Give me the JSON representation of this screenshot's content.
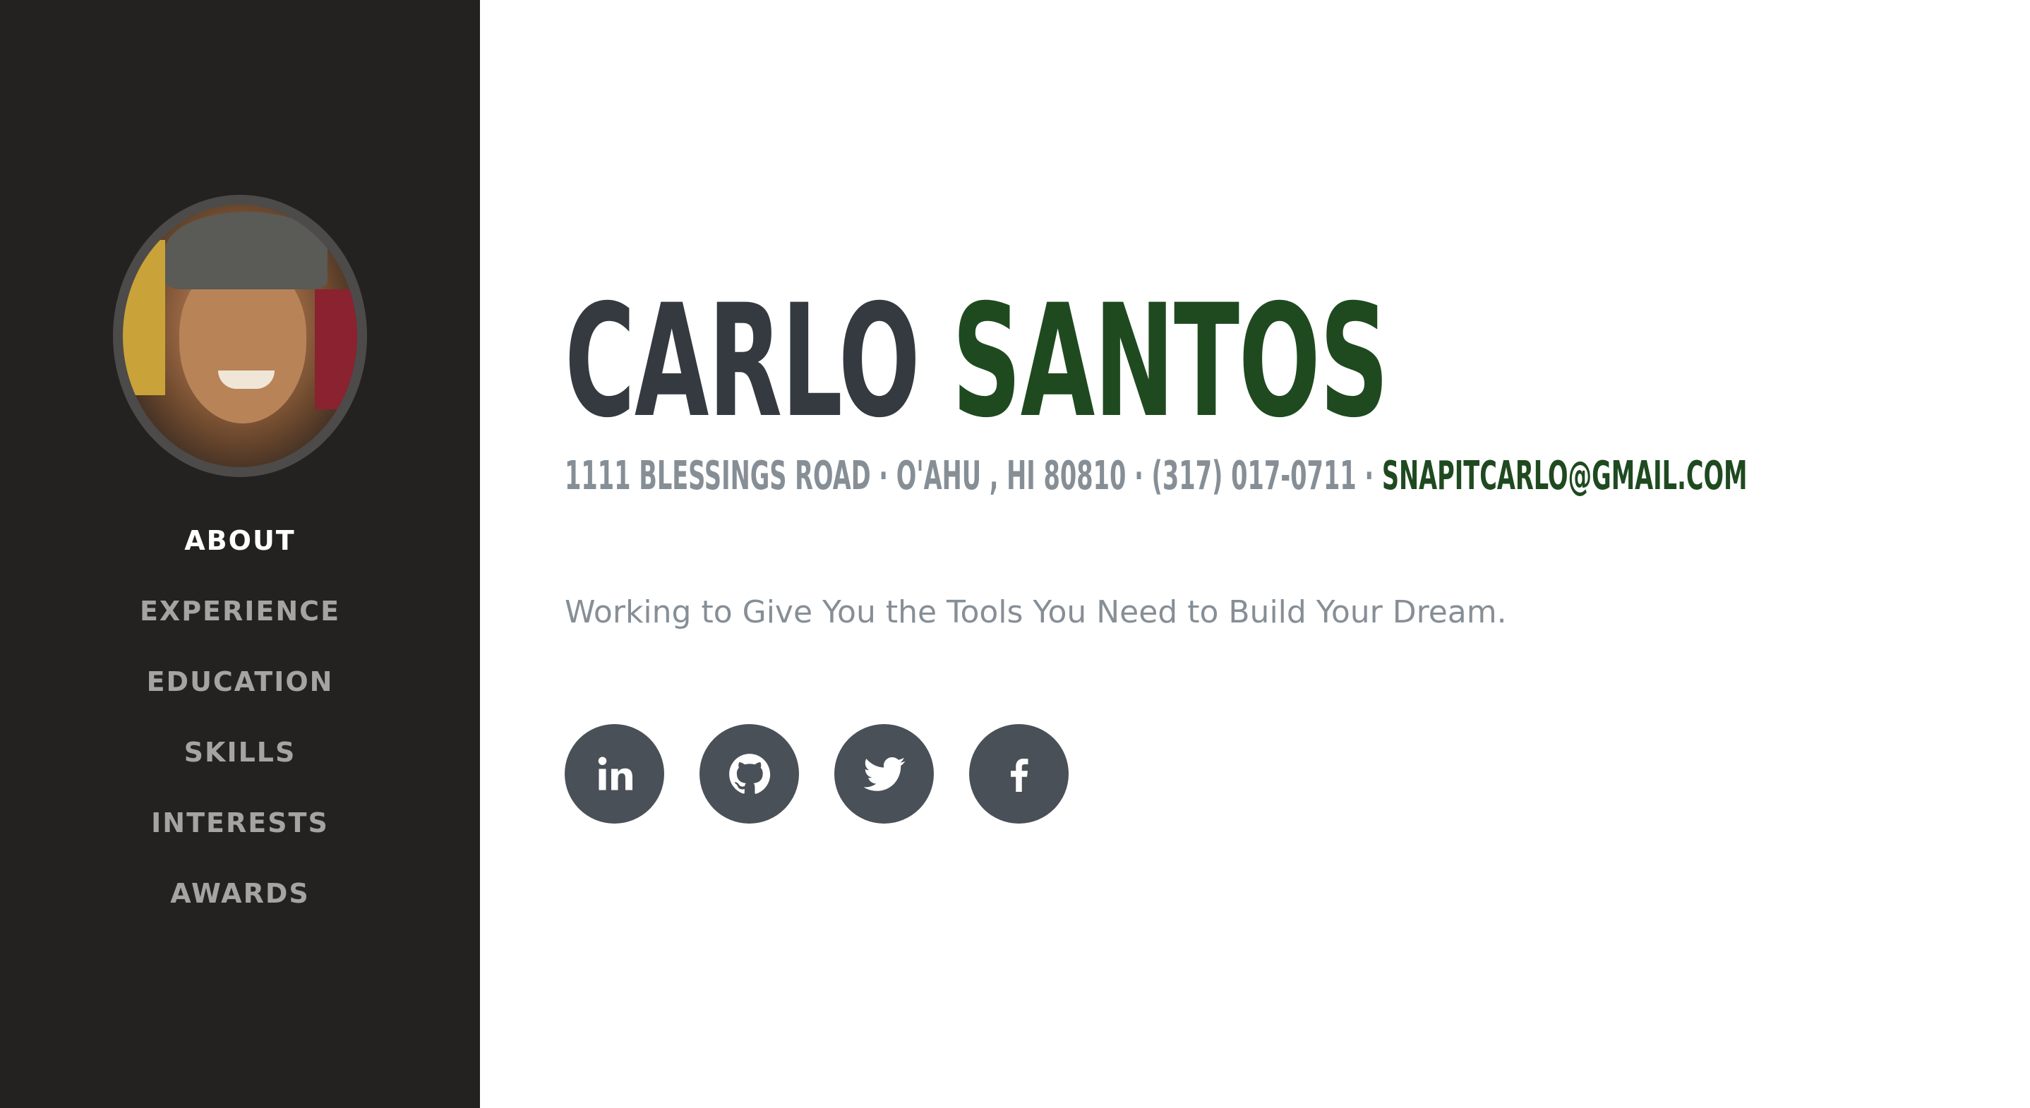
{
  "sidebar": {
    "nav": [
      "ABOUT",
      "EXPERIENCE",
      "EDUCATION",
      "SKILLS",
      "INTERESTS",
      "AWARDS"
    ],
    "active": "ABOUT"
  },
  "header": {
    "first_name": "CARLO",
    "last_name": "SANTOS"
  },
  "contact": {
    "address": "1111 BLESSINGS ROAD · O'AHU , HI 80810 · (317) 017-0711 · ",
    "email": "SNAPITCARLO@GMAIL.COM"
  },
  "tagline": "Working to Give You the Tools You Need to Build Your Dream.",
  "social": [
    "linkedin-icon",
    "github-icon",
    "twitter-icon",
    "facebook-icon"
  ],
  "colors": {
    "sidebar_bg": "#232221",
    "accent_green": "#1f4a20",
    "name_dark": "#343a40",
    "muted_text": "#868e96",
    "social_circle": "#495057"
  }
}
